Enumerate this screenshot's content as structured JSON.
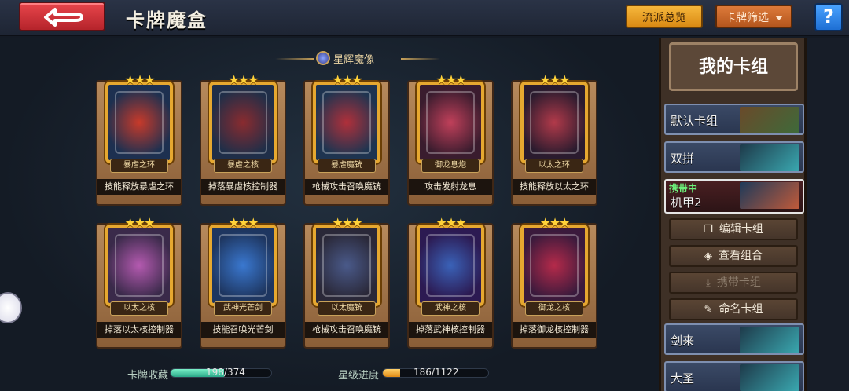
{
  "header": {
    "title": "卡牌魔盒",
    "faction_label": "流派总览",
    "filter_label": "卡牌筛选",
    "help_label": "?"
  },
  "section": {
    "title": "星辉魔像"
  },
  "cards": [
    {
      "art_label": "暴虐之环",
      "desc": "技能释放暴虐之环",
      "stars": 3,
      "art_colors": [
        "#1d3050",
        "#c83a2a"
      ]
    },
    {
      "art_label": "暴虐之核",
      "desc": "掉落暴虐核控制器",
      "stars": 3,
      "art_colors": [
        "#1f2e48",
        "#8a2b2f"
      ]
    },
    {
      "art_label": "暴虐魔铳",
      "desc": "枪械攻击召唤魔铳",
      "stars": 3,
      "art_colors": [
        "#1e3450",
        "#b0303a"
      ]
    },
    {
      "art_label": "御龙息炮",
      "desc": "攻击发射龙息",
      "stars": 3,
      "art_colors": [
        "#3a1c2e",
        "#c0405a"
      ]
    },
    {
      "art_label": "以太之环",
      "desc": "技能释放以太之环",
      "stars": 3,
      "art_colors": [
        "#2a1b2e",
        "#b23a4a"
      ]
    },
    {
      "art_label": "以太之核",
      "desc": "掉落以太核控制器",
      "stars": 3,
      "art_colors": [
        "#3a2a4a",
        "#b45ab0"
      ]
    },
    {
      "art_label": "武神光芒剑",
      "desc": "技能召唤光芒剑",
      "stars": 3,
      "art_colors": [
        "#1e3660",
        "#3a78d0"
      ]
    },
    {
      "art_label": "以太魔铳",
      "desc": "枪械攻击召唤魔铳",
      "stars": 3,
      "art_colors": [
        "#2a2838",
        "#4a5a8a"
      ]
    },
    {
      "art_label": "武神之核",
      "desc": "掉落武神核控制器",
      "stars": 3,
      "art_colors": [
        "#2c1a52",
        "#3a62b8"
      ]
    },
    {
      "art_label": "御龙之核",
      "desc": "掉落御龙核控制器",
      "stars": 3,
      "art_colors": [
        "#3a1a3c",
        "#b52a4a"
      ]
    }
  ],
  "footer": {
    "collection_label": "卡牌收藏",
    "collection_value": "198/374",
    "collection_fraction": 0.529,
    "star_label": "星级进度",
    "star_value": "186/1122",
    "star_fraction": 0.166
  },
  "deck": {
    "title": "我的卡组",
    "carrying_label": "携带中",
    "items": [
      {
        "name": "默认卡组",
        "thumb": "#3e6a3a"
      },
      {
        "name": "双拼",
        "thumb": "#3aa8b0"
      },
      {
        "name": "机甲2",
        "thumb": "#2a4a6a",
        "active": true
      },
      {
        "name": "剑来",
        "thumb": "#3aa8b0"
      },
      {
        "name": "大圣",
        "thumb": "#3aa8b0"
      }
    ],
    "actions": {
      "edit": "编辑卡组",
      "view": "查看组合",
      "carry": "携带卡组",
      "rename": "命名卡组"
    }
  },
  "colors": {
    "accent_gold": "#e6a830",
    "progress_green": "#3ad0a0",
    "progress_orange": "#f2a82e"
  }
}
